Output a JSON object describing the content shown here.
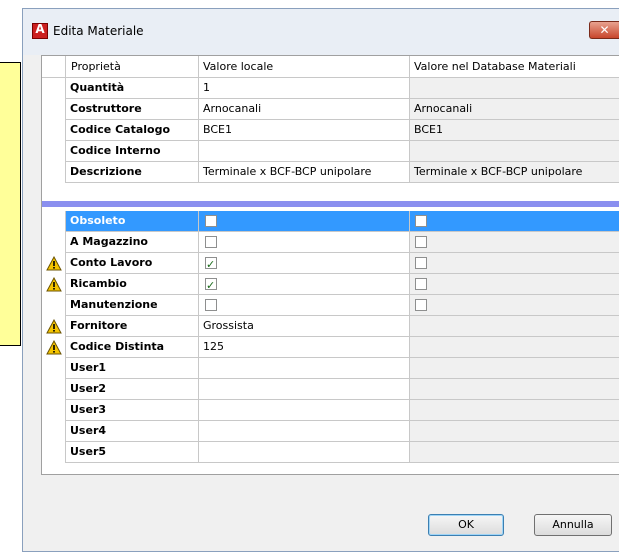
{
  "window": {
    "title": "Edita Materiale",
    "close_label": "✕"
  },
  "columns": {
    "prop": "Proprietà",
    "local": "Valore locale",
    "db": "Valore nel Database Materiali"
  },
  "top_rows": [
    {
      "label": "Quantità",
      "local": "1",
      "db": ""
    },
    {
      "label": "Costruttore",
      "local": "Arnocanali",
      "db": "Arnocanali"
    },
    {
      "label": "Codice Catalogo",
      "local": "BCE1",
      "db": "BCE1"
    },
    {
      "label": "Codice Interno",
      "local": "",
      "db": ""
    },
    {
      "label": "Descrizione",
      "local": "Terminale x BCF-BCP unipolare",
      "db": "Terminale x BCF-BCP unipolare"
    }
  ],
  "bottom_rows": [
    {
      "label": "Obsoleto",
      "warn": false,
      "type": "checkbox",
      "local_checked": false,
      "db_checked": false,
      "selected": true
    },
    {
      "label": "A Magazzino",
      "warn": false,
      "type": "checkbox",
      "local_checked": false,
      "db_checked": false
    },
    {
      "label": "Conto Lavoro",
      "warn": true,
      "type": "checkbox",
      "local_checked": true,
      "db_checked": false
    },
    {
      "label": "Ricambio",
      "warn": true,
      "type": "checkbox",
      "local_checked": true,
      "db_checked": false
    },
    {
      "label": "Manutenzione",
      "warn": false,
      "type": "checkbox",
      "local_checked": false,
      "db_checked": false
    },
    {
      "label": "Fornitore",
      "warn": true,
      "type": "text",
      "local": "Grossista",
      "db": ""
    },
    {
      "label": "Codice Distinta",
      "warn": true,
      "type": "text",
      "local": "125",
      "db": ""
    },
    {
      "label": "User1",
      "warn": false,
      "type": "text",
      "local": "",
      "db": ""
    },
    {
      "label": "User2",
      "warn": false,
      "type": "text",
      "local": "",
      "db": ""
    },
    {
      "label": "User3",
      "warn": false,
      "type": "text",
      "local": "",
      "db": ""
    },
    {
      "label": "User4",
      "warn": false,
      "type": "text",
      "local": "",
      "db": ""
    },
    {
      "label": "User5",
      "warn": false,
      "type": "text",
      "local": "",
      "db": ""
    }
  ],
  "buttons": {
    "ok": "OK",
    "cancel": "Annulla"
  },
  "colors": {
    "selection": "#3399ff",
    "separator": "#8a8fef",
    "warning": "#f5c400"
  }
}
